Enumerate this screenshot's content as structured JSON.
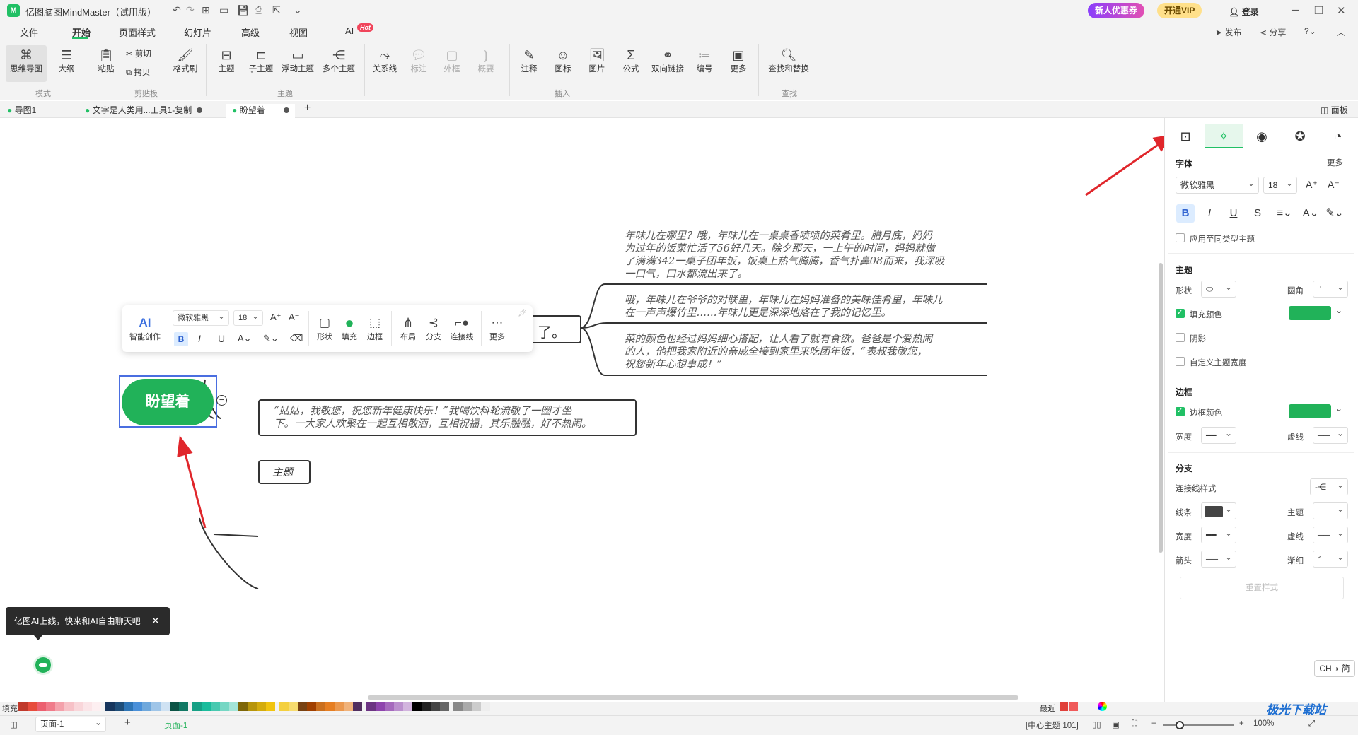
{
  "titlebar": {
    "app_title": "亿图脑图MindMaster（试用版）",
    "promo_new": "新人优惠券",
    "promo_vip": "开通VIP",
    "login": "登录"
  },
  "menu": {
    "tabs": [
      "文件",
      "开始",
      "页面样式",
      "幻灯片",
      "高级",
      "视图",
      "AI"
    ],
    "active": "开始",
    "hot_badge": "Hot",
    "right": {
      "publish": "发布",
      "share": "分享"
    }
  },
  "ribbon": {
    "mindmap": "思维导图",
    "outline": "大纲",
    "paste": "粘贴",
    "cut": "剪切",
    "copy": "拷贝",
    "format_painter": "格式刷",
    "topic": "主题",
    "subtopic": "子主题",
    "floating_topic": "浮动主题",
    "multi_topic": "多个主题",
    "relation": "关系线",
    "callout": "标注",
    "boundary": "外框",
    "summary": "概要",
    "note": "注释",
    "icon": "图标",
    "image": "图片",
    "formula": "公式",
    "bilink": "双向链接",
    "numbering": "编号",
    "more": "更多",
    "find_replace": "查找和替换",
    "groups": {
      "mode": "模式",
      "clipboard": "剪贴板",
      "topic": "主题",
      "insert": "插入",
      "find": "查找"
    }
  },
  "doc_tabs": [
    {
      "label": "导图1"
    },
    {
      "label": "文字是人类用...工具1-复制"
    },
    {
      "label": "盼望着"
    }
  ],
  "panel_toggle": "面板",
  "mindmap": {
    "central": "盼望着",
    "paragraph1": [
      "年味儿在哪里？哦，年味儿在一桌桌香喷喷的菜肴里。腊月底，妈妈",
      "为过年的饭菜忙活了56好几天。除夕那天，一上午的时间，妈妈就做",
      "了满满342一桌子团年饭，饭桌上热气腾腾，香气扑鼻08而来，我深吸",
      "一口气，口水都流出来了。"
    ],
    "paragraph2": [
      "哦，年味儿在爷爷的对联里，年味儿在妈妈准备的美味佳肴里，年味儿",
      "在一声声爆竹里……年味儿更是深深地烙在了我的记忆里。"
    ],
    "paragraph3": [
      "菜的颜色也经过妈妈细心搭配，让人看了就有食欲。爸爸是个爱热闹",
      "的人，他把我家附近的亲戚全接到家里来吃团年饭，“表叔我敬您，",
      "祝您新年心想事成！”"
    ],
    "greeting": [
      "“姑姑，我敬您，祝您新年健康快乐！”我喝饮料轮流敬了一圈才坐",
      "下。一大家人欢聚在一起互相敬酒，互相祝福，其乐融融，好不热闹。"
    ],
    "hidden_partial": "了。",
    "topic": "主题"
  },
  "float_toolbar": {
    "ai": "AI",
    "ai_label": "智能创作",
    "font": "微软雅黑",
    "size": "18",
    "shape": "形状",
    "fill": "填充",
    "border": "边框",
    "layout": "布局",
    "branch": "分支",
    "connector": "连接线",
    "more": "更多"
  },
  "panel": {
    "font_header": "字体",
    "more": "更多",
    "font": "微软雅黑",
    "size": "18",
    "apply_same": "应用至同类型主题",
    "topic_header": "主题",
    "shape": "形状",
    "corner": "圆角",
    "fill_color": "填充颜色",
    "shadow": "阴影",
    "custom_width": "自定义主题宽度",
    "border_header": "边框",
    "border_color": "边框颜色",
    "width": "宽度",
    "dash": "虚线",
    "branch_header": "分支",
    "connector_style": "连接线样式",
    "line": "线条",
    "topic": "主题",
    "arrow": "箭头",
    "taper": "渐细",
    "reset": "重置样式",
    "accent": "#21b259"
  },
  "ai_tip": "亿图AI上线，快来和AI自由聊天吧",
  "ime": "CH ◑ 简",
  "palette": {
    "fill_label": "填充",
    "recent_label": "最近"
  },
  "status": {
    "page": "页面-1",
    "page_tab": "页面-1",
    "center": "[中心主题 101]",
    "zoom": "100%"
  },
  "watermark": "极光下载站"
}
